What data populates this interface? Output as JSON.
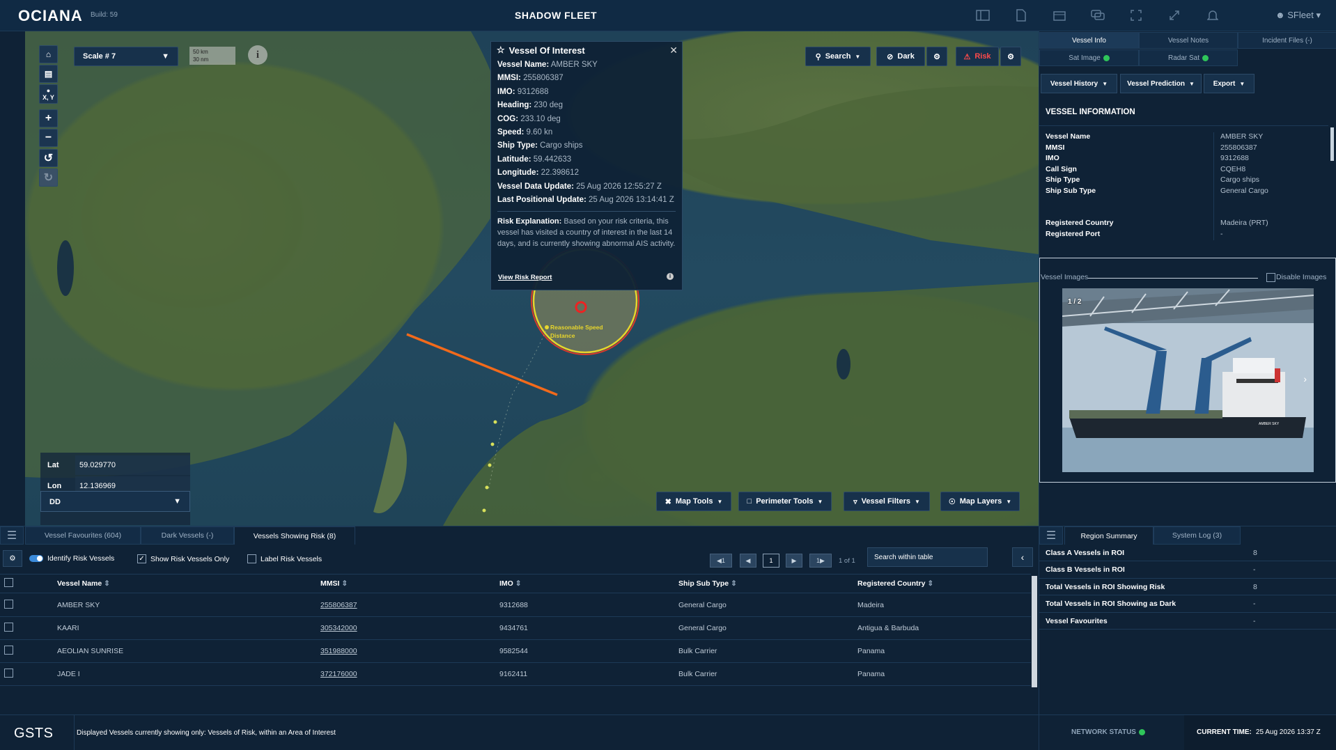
{
  "app": {
    "logo": "OCIANA",
    "build": "Build: 59",
    "title": "SHADOW FLEET",
    "user": "SFleet"
  },
  "map": {
    "scale_select": "Scale # 7",
    "scale_km": "50 km",
    "scale_nm": "30 nm",
    "xy_label": "X, Y",
    "search_label": "Search",
    "dark_label": "Dark",
    "risk_label": "Risk",
    "map_tools": "Map Tools",
    "perimeter_tools": "Perimeter Tools",
    "vessel_filters": "Vessel Filters",
    "map_layers": "Map Layers",
    "lat_label": "Lat",
    "lat_value": "59.029770",
    "lon_label": "Lon",
    "lon_value": "12.136969",
    "coord_format": "DD",
    "circle_label_1": "Reasonable Speed",
    "circle_label_2": "Distance"
  },
  "popup": {
    "title": "Vessel Of Interest",
    "rows": [
      {
        "label": "Vessel Name:",
        "value": "AMBER SKY"
      },
      {
        "label": "MMSI:",
        "value": "255806387"
      },
      {
        "label": "IMO:",
        "value": "9312688"
      },
      {
        "label": "Heading:",
        "value": "230 deg"
      },
      {
        "label": "COG:",
        "value": "233.10 deg"
      },
      {
        "label": "Speed:",
        "value": "9.60 kn"
      },
      {
        "label": "Ship Type:",
        "value": "Cargo ships"
      },
      {
        "label": "Latitude:",
        "value": "59.442633"
      },
      {
        "label": "Longitude:",
        "value": "22.398612"
      },
      {
        "label": "Vessel Data Update:",
        "value": "25 Aug 2026 12:55:27 Z"
      },
      {
        "label": "Last Positional Update:",
        "value": "25 Aug 2026 13:14:41 Z"
      }
    ],
    "risk_label": "Risk Explanation:",
    "risk_text": "Based on your risk criteria, this vessel has visited a country of interest in the last 14 days, and is currently showing abnormal AIS activity.",
    "report_link": "View Risk Report"
  },
  "right": {
    "tabs": [
      "Vessel Info",
      "Vessel Notes",
      "Incident Files (-)"
    ],
    "sat_image": "Sat Image",
    "radar_sat": "Radar Sat",
    "buttons": [
      "Vessel History",
      "Vessel Prediction",
      "Export"
    ],
    "heading": "VESSEL INFORMATION",
    "info": [
      {
        "label": "Vessel Name",
        "value": "AMBER SKY"
      },
      {
        "label": "MMSI",
        "value": "255806387"
      },
      {
        "label": "IMO",
        "value": "9312688"
      },
      {
        "label": "Call Sign",
        "value": "CQEH8"
      },
      {
        "label": "Ship Type",
        "value": "Cargo ships"
      },
      {
        "label": "Ship Sub Type",
        "value": "General Cargo"
      },
      {
        "label": "",
        "value": ""
      },
      {
        "label": "",
        "value": ""
      },
      {
        "label": "Registered Country",
        "value": "Madeira (PRT)"
      },
      {
        "label": "Registered Port",
        "value": "-"
      }
    ],
    "images_label": "Vessel Images",
    "disable_images": "Disable Images",
    "image_counter": "1 / 2",
    "ship_name_on_hull": "AMBER SKY"
  },
  "bottom": {
    "tabs": [
      "Vessel Favourites (604)",
      "Dark Vessels (-)",
      "Vessels Showing Risk (8)"
    ],
    "identify": "Identify Risk Vessels",
    "show_only": "Show Risk Vessels Only",
    "label_risk": "Label Risk Vessels",
    "page": "1",
    "page_of": "1 of 1",
    "search_placeholder": "Search within table",
    "columns": [
      "Vessel Name",
      "MMSI",
      "IMO",
      "Ship Sub Type",
      "Registered Country"
    ],
    "rows": [
      {
        "name": "AMBER SKY",
        "mmsi": "255806387",
        "imo": "9312688",
        "sub": "General Cargo",
        "country": "Madeira"
      },
      {
        "name": "KAARI",
        "mmsi": "305342000",
        "imo": "9434761",
        "sub": "General Cargo",
        "country": "Antigua & Barbuda"
      },
      {
        "name": "AEOLIAN SUNRISE",
        "mmsi": "351988000",
        "imo": "9582544",
        "sub": "Bulk Carrier",
        "country": "Panama"
      },
      {
        "name": "JADE I",
        "mmsi": "372176000",
        "imo": "9162411",
        "sub": "Bulk Carrier",
        "country": "Panama"
      }
    ]
  },
  "summary": {
    "tabs": [
      "Region Summary",
      "System Log (3)"
    ],
    "rows": [
      {
        "label": "Class A Vessels in ROI",
        "value": "8"
      },
      {
        "label": "Class B Vessels in ROI",
        "value": "-"
      },
      {
        "label": "Total Vessels in ROI Showing Risk",
        "value": "8"
      },
      {
        "label": "Total Vessels in ROI Showing as Dark",
        "value": "-"
      },
      {
        "label": "Vessel Favourites",
        "value": "-"
      }
    ]
  },
  "footer": {
    "brand": "GSTS",
    "message": "Displayed Vessels currently showing only: Vessels of Risk, within an Area of Interest",
    "network": "NETWORK STATUS",
    "time_label": "CURRENT TIME:",
    "time_value": "25 Aug 2026 13:37 Z"
  }
}
